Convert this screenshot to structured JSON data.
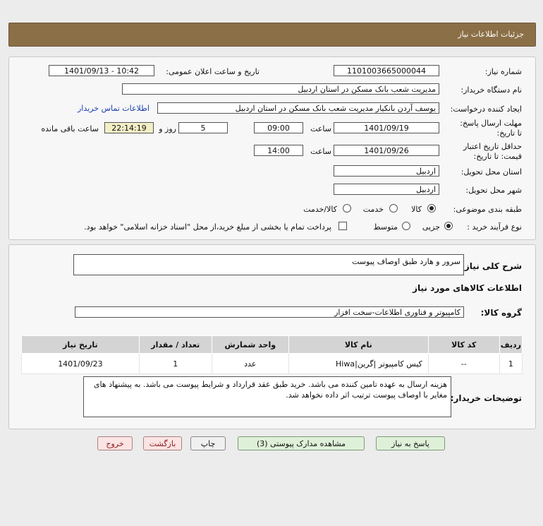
{
  "header": {
    "title": "جزئیات اطلاعات نیاز"
  },
  "details": {
    "need_number_label": "شماره نیاز:",
    "need_number": "1101003665000044",
    "announce_label": "تاریخ و ساعت اعلان عمومی:",
    "announce_value": "1401/09/13 - 10:42",
    "buyer_org_label": "نام دستگاه خریدار:",
    "buyer_org": "مدیریت شعب بانک مسکن در استان اردبیل",
    "requester_label": "ایجاد کننده درخواست:",
    "requester": "یوسف  آردن بانکیار مدیریت شعب بانک مسکن در استان اردبیل",
    "contact_link": "اطلاعات تماس خریدار",
    "deadline_label": "مهلت ارسال پاسخ: تا تاریخ:",
    "deadline_date": "1401/09/19",
    "time_label": "ساعت",
    "deadline_time": "09:00",
    "days_value": "5",
    "days_label": "روز و",
    "remaining_time": "22:14:19",
    "remaining_label": "ساعت باقی مانده",
    "validity_label": "حداقل تاریخ اعتبار قیمت: تا تاریخ:",
    "validity_date": "1401/09/26",
    "validity_time": "14:00",
    "delivery_place_label": "استان محل تحویل:",
    "delivery_place": "اردبیل",
    "delivery_city_label": "شهر محل تحویل:",
    "delivery_city": "اردبیل",
    "category_label": "طبقه بندی موضوعی:",
    "category_options": [
      "کالا",
      "خدمت",
      "کالا/خدمت"
    ],
    "process_label": "نوع فرآیند خرید :",
    "process_options": [
      "جزیی",
      "متوسط"
    ],
    "payment_note": "پرداخت تمام یا بخشی از مبلغ خرید،از محل \"اسناد خزانه اسلامی\" خواهد بود."
  },
  "summary": {
    "label": "شرح کلی نیاز:",
    "value": "سرور و هارد طبق اوصاف پیوست",
    "goods_info_title": "اطلاعات کالاهای مورد نیاز",
    "group_label": "گروه کالا:",
    "group_value": "کامپیوتر و فناوری اطلاعات-سخت افزار"
  },
  "table": {
    "headers": [
      "ردیف",
      "کد کالا",
      "نام کالا",
      "واحد شمارش",
      "تعداد / مقدار",
      "تاریخ نیاز"
    ],
    "rows": [
      [
        "1",
        "--",
        "کیس کامپیوتر |گرین|Hiwa",
        "عدد",
        "1",
        "1401/09/23"
      ]
    ]
  },
  "buyer_notes": {
    "label": "توضیحات خریدار:",
    "text": "هزینه ارسال به عهده تامین کننده می باشد. خرید طبق عقد قرارداد و شرایط پیوست می باشد. به پیشنهاد های مغایر با اوصاف پیوست ترتیب اثر داده نخواهد شد."
  },
  "buttons": {
    "reply": "پاسخ به نیاز",
    "attachments": "مشاهده مدارک پیوستی (3)",
    "print": "چاپ",
    "back": "بازگشت",
    "exit": "خروج"
  }
}
